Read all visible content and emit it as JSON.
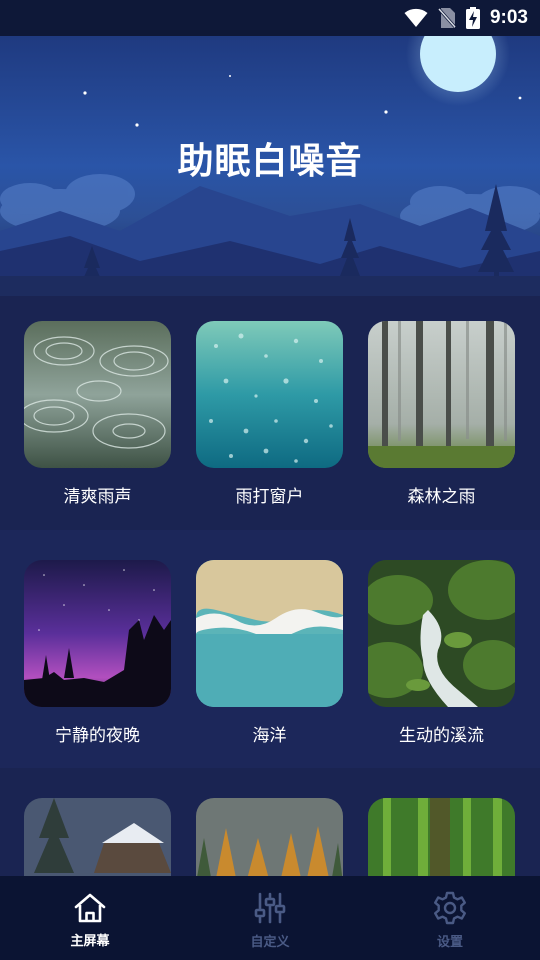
{
  "status_bar": {
    "time": "9:03"
  },
  "header": {
    "title": "助眠白噪音"
  },
  "sounds": [
    {
      "label": "清爽雨声",
      "image": "rain-ripples-photo"
    },
    {
      "label": "雨打窗户",
      "image": "rain-on-window-photo"
    },
    {
      "label": "森林之雨",
      "image": "misty-forest-photo"
    },
    {
      "label": "宁静的夜晚",
      "image": "starry-night-photo"
    },
    {
      "label": "海洋",
      "image": "ocean-beach-photo"
    },
    {
      "label": "生动的溪流",
      "image": "forest-stream-photo"
    },
    {
      "label": "",
      "image": "snowy-cabin-photo"
    },
    {
      "label": "",
      "image": "autumn-forest-photo"
    },
    {
      "label": "",
      "image": "bamboo-forest-photo"
    }
  ],
  "bottom_nav": {
    "items": [
      {
        "label": "主屏幕",
        "icon": "home-icon",
        "active": true
      },
      {
        "label": "自定义",
        "icon": "equalizer-icon",
        "active": false
      },
      {
        "label": "设置",
        "icon": "gear-icon",
        "active": false
      }
    ]
  },
  "colors": {
    "background": "#1a2452",
    "nav_background": "#0b1433",
    "active": "#ffffff",
    "inactive": "#4a5a85"
  }
}
